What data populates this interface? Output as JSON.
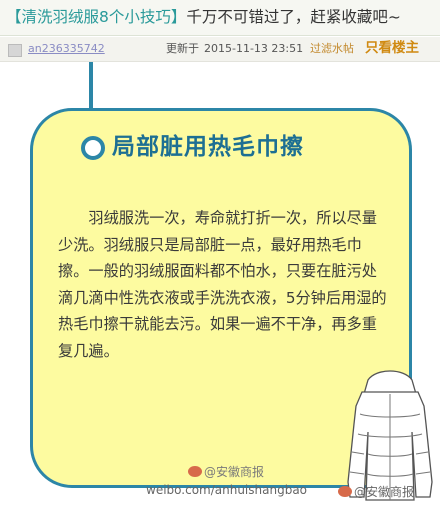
{
  "header": {
    "title_tag": "【清洗羽绒服8个小技巧】",
    "title_rest": "千万不可错过了，赶紧收藏吧~"
  },
  "meta": {
    "username": "an236335742",
    "updated_label": "更新于",
    "updated_time": "2015-11-13 23:51",
    "filter_link": "过滤水帖",
    "owner_only": "只看楼主"
  },
  "card": {
    "heading": "局部脏用热毛巾擦",
    "paragraph": "羽绒服洗一次，寿命就打折一次，所以尽量少洗。羽绒服只是局部脏一点，最好用热毛巾擦。一般的羽绒服面料都不怕水，只要在脏污处滴几滴中性洗衣液或手洗洗衣液，5分钟后用湿的热毛巾擦干就能去污。如果一遍不干净，再多重复几遍。"
  },
  "watermark": {
    "weibo": "@安徽商报",
    "url": "weibo.com/anhuishangbao",
    "tail": "@安徽商报"
  },
  "colors": {
    "accent": "#2c86a7",
    "card_bg": "#fdfba0",
    "title_tag": "#2a9a9a",
    "owner_only": "#d08a12"
  }
}
